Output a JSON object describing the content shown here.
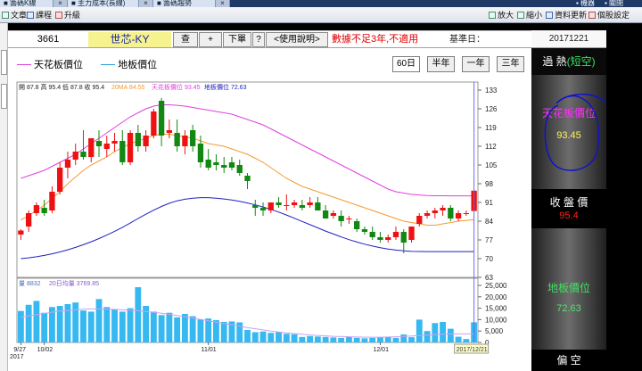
{
  "tabs": [
    {
      "label": "■ 籌碼K線",
      "width": 60
    },
    {
      "label": "■ 主力成本(長線)",
      "width": 80
    },
    {
      "label": "■ 籌碼趨勢",
      "width": 70
    }
  ],
  "tabs_right": {
    "label1": "▪ 機器",
    "label2": "▪ 關閉"
  },
  "toolbar": {
    "left": [
      {
        "icon": "file-icon",
        "label": "文章"
      },
      {
        "icon": "book-icon",
        "label": "課程"
      },
      {
        "icon": "upgrade-icon",
        "label": "升級"
      }
    ],
    "right": [
      {
        "icon": "zoom-in-icon",
        "label": "放大"
      },
      {
        "icon": "zoom-out-icon",
        "label": "縮小"
      },
      {
        "icon": "refresh-icon",
        "label": "資料更新"
      },
      {
        "icon": "settings-icon",
        "label": "個股設定"
      }
    ]
  },
  "info": {
    "code": "3661",
    "name": "世芯-KY",
    "btn_check": "查",
    "btn_add": "+",
    "btn_order": "下單",
    "btn_help": "?",
    "btn_manual": "<使用說明>",
    "warning": "數據不足3年,不適用",
    "base_label": "基準日：",
    "base_date": "20171221"
  },
  "legend": {
    "ceiling": "天花板價位",
    "floor": "地板價位"
  },
  "range_buttons": [
    {
      "label": "60日",
      "active": true
    },
    {
      "label": "半年",
      "active": false
    },
    {
      "label": "一年",
      "active": false
    },
    {
      "label": "三年",
      "active": false
    }
  ],
  "side": {
    "status_prefix": "過 熱",
    "status_suffix": "(短空)",
    "ceiling_label": "天花板價位",
    "ceiling_value": "93.45",
    "close_label": "收 盤 價",
    "close_value": "95.4",
    "floor_label": "地板價位",
    "floor_value": "72.63",
    "bottom_label": "偏 空"
  },
  "colors": {
    "up": "#ee1111",
    "down": "#118811",
    "ceiling": "#e040e0",
    "floor": "#2020c0",
    "ma20": "#f59a30",
    "volume": "#36b8f0",
    "vol_ma": "#c9a2f0"
  },
  "chart_data": {
    "type": "candlestick",
    "ohlc_header": "開 87.8 高 95.4 低 87.8 收 95.4",
    "ma_label": "20MA 84.55",
    "ceiling_label": "天花板價位 93.45",
    "floor_label": "地板價位 72.63",
    "vol_header": "量 8832",
    "vol_ma_label": "20日均量 3769.85",
    "yticks": [
      63,
      70,
      77,
      84,
      91,
      98,
      105,
      112,
      119,
      126,
      133
    ],
    "ylim": [
      63,
      136
    ],
    "vol_ticks": [
      0,
      5000,
      10000,
      15000,
      20000,
      25000
    ],
    "vol_tick_labels": [
      "0",
      "5,000",
      "10,000",
      "15,000",
      "20,000",
      "25,000"
    ],
    "vol_max": 25000,
    "x_labels": [
      {
        "index": 0,
        "label": "9/27"
      },
      {
        "index": 3,
        "label": "10/02"
      },
      {
        "index": 24,
        "label": "11/01"
      },
      {
        "index": 46,
        "label": "12/01"
      }
    ],
    "x_year": "2017",
    "cursor_label": "2017/12/21",
    "candles": [
      {
        "o": 79,
        "h": 81,
        "l": 77,
        "c": 80.5
      },
      {
        "o": 82,
        "h": 88,
        "l": 80,
        "c": 87
      },
      {
        "o": 87,
        "h": 91,
        "l": 86,
        "c": 90
      },
      {
        "o": 89,
        "h": 92,
        "l": 86,
        "c": 87
      },
      {
        "o": 88,
        "h": 97,
        "l": 87,
        "c": 95
      },
      {
        "o": 95,
        "h": 106,
        "l": 94,
        "c": 104
      },
      {
        "o": 104,
        "h": 110,
        "l": 100,
        "c": 107
      },
      {
        "o": 107,
        "h": 113,
        "l": 105,
        "c": 110
      },
      {
        "o": 110,
        "h": 118,
        "l": 107,
        "c": 108
      },
      {
        "o": 108,
        "h": 115,
        "l": 106,
        "c": 115
      },
      {
        "o": 114,
        "h": 118,
        "l": 108,
        "c": 112
      },
      {
        "o": 111,
        "h": 116,
        "l": 108,
        "c": 113
      },
      {
        "o": 113,
        "h": 117,
        "l": 110,
        "c": 114
      },
      {
        "o": 114,
        "h": 118,
        "l": 105,
        "c": 106
      },
      {
        "o": 106,
        "h": 118,
        "l": 105,
        "c": 117
      },
      {
        "o": 117,
        "h": 120,
        "l": 110,
        "c": 112
      },
      {
        "o": 112,
        "h": 118,
        "l": 110,
        "c": 116
      },
      {
        "o": 116,
        "h": 126,
        "l": 115,
        "c": 125
      },
      {
        "o": 129,
        "h": 130,
        "l": 112,
        "c": 116
      },
      {
        "o": 117,
        "h": 122,
        "l": 115,
        "c": 118
      },
      {
        "o": 117,
        "h": 122,
        "l": 110,
        "c": 112
      },
      {
        "o": 112,
        "h": 118,
        "l": 109,
        "c": 116
      },
      {
        "o": 118,
        "h": 120,
        "l": 110,
        "c": 112
      },
      {
        "o": 113,
        "h": 116,
        "l": 104,
        "c": 106
      },
      {
        "o": 107,
        "h": 111,
        "l": 103,
        "c": 104
      },
      {
        "o": 106,
        "h": 109,
        "l": 103,
        "c": 105
      },
      {
        "o": 105,
        "h": 108,
        "l": 102,
        "c": 104
      },
      {
        "o": 106,
        "h": 108,
        "l": 103,
        "c": 104
      },
      {
        "o": 105,
        "h": 107,
        "l": 101,
        "c": 102
      },
      {
        "o": 101,
        "h": 102,
        "l": 96,
        "c": 99
      },
      {
        "o": 90,
        "h": 92,
        "l": 86,
        "c": 89
      },
      {
        "o": 89,
        "h": 91,
        "l": 86,
        "c": 88
      },
      {
        "o": 88,
        "h": 91,
        "l": 87,
        "c": 91
      },
      {
        "o": 91,
        "h": 93,
        "l": 89,
        "c": 90
      },
      {
        "o": 90,
        "h": 94,
        "l": 88,
        "c": 90
      },
      {
        "o": 90,
        "h": 92,
        "l": 89,
        "c": 91
      },
      {
        "o": 90,
        "h": 92,
        "l": 88,
        "c": 89
      },
      {
        "o": 90,
        "h": 93,
        "l": 89,
        "c": 91
      },
      {
        "o": 91,
        "h": 93,
        "l": 88,
        "c": 88
      },
      {
        "o": 88,
        "h": 90,
        "l": 85,
        "c": 85
      },
      {
        "o": 86,
        "h": 88,
        "l": 85,
        "c": 87
      },
      {
        "o": 86,
        "h": 88,
        "l": 82,
        "c": 84
      },
      {
        "o": 85,
        "h": 86,
        "l": 83,
        "c": 85
      },
      {
        "o": 84,
        "h": 85,
        "l": 80,
        "c": 81
      },
      {
        "o": 81,
        "h": 82,
        "l": 79,
        "c": 80
      },
      {
        "o": 80,
        "h": 82,
        "l": 77,
        "c": 78
      },
      {
        "o": 78,
        "h": 80,
        "l": 76,
        "c": 77
      },
      {
        "o": 77,
        "h": 79,
        "l": 76,
        "c": 78
      },
      {
        "o": 78,
        "h": 82,
        "l": 77,
        "c": 80
      },
      {
        "o": 80,
        "h": 81,
        "l": 72,
        "c": 76
      },
      {
        "o": 77,
        "h": 82,
        "l": 76,
        "c": 82
      },
      {
        "o": 83,
        "h": 87,
        "l": 82,
        "c": 86
      },
      {
        "o": 86,
        "h": 88,
        "l": 85,
        "c": 87
      },
      {
        "o": 87,
        "h": 89,
        "l": 85,
        "c": 88
      },
      {
        "o": 88,
        "h": 90,
        "l": 86,
        "c": 89
      },
      {
        "o": 89,
        "h": 90,
        "l": 84,
        "c": 85
      },
      {
        "o": 85,
        "h": 88,
        "l": 84,
        "c": 87
      },
      {
        "o": 87,
        "h": 88,
        "l": 86,
        "c": 87
      },
      {
        "o": 87.8,
        "h": 95.4,
        "l": 87.8,
        "c": 95.4
      }
    ],
    "ma20": [
      84.5,
      86,
      88,
      90,
      92.5,
      95,
      98,
      100.5,
      103,
      105,
      106.5,
      108,
      110,
      111.5,
      113,
      114,
      115,
      116,
      116.5,
      116.5,
      116,
      115.5,
      115,
      114,
      113,
      112.5,
      112,
      111,
      110,
      109,
      107.5,
      106,
      104,
      102,
      100,
      98.5,
      97,
      96,
      95,
      94,
      93,
      92,
      91,
      90,
      89,
      88,
      87,
      86,
      85,
      84,
      83.5,
      83,
      82.5,
      82.5,
      83,
      83.5,
      84,
      84.3,
      84.55
    ],
    "ceiling": [
      100,
      101,
      102,
      103,
      104.5,
      106,
      107.5,
      109,
      111,
      113,
      115,
      117,
      119,
      121,
      123,
      124.5,
      126,
      127,
      127.5,
      127.5,
      127.3,
      127,
      126.5,
      126,
      125.5,
      125,
      124.5,
      124,
      123,
      122,
      121,
      120,
      118.5,
      117,
      115.5,
      114,
      112.5,
      111,
      109.5,
      108,
      106.5,
      105,
      103.5,
      102,
      100.5,
      99,
      97.5,
      96,
      95,
      94.5,
      94,
      93.8,
      93.6,
      93.5,
      93.5,
      93.45,
      93.45,
      93.45,
      93.45
    ],
    "floor": [
      70,
      70.3,
      70.7,
      71.2,
      71.8,
      72.5,
      73.3,
      74.2,
      75.2,
      76.3,
      77.5,
      78.8,
      80.2,
      81.7,
      83.3,
      85,
      86.6,
      88.1,
      89.5,
      90.7,
      91.6,
      92.2,
      92.6,
      92.8,
      92.8,
      92.6,
      92.3,
      91.9,
      91.4,
      90.8,
      90.1,
      89.3,
      88.4,
      87.4,
      86.3,
      85.1,
      83.9,
      82.7,
      81.5,
      80.3,
      79.2,
      78.1,
      77.1,
      76.2,
      75.4,
      74.7,
      74.1,
      73.6,
      73.2,
      72.9,
      72.7,
      72.65,
      72.63,
      72.63,
      72.63,
      72.63,
      72.63,
      72.63,
      72.63
    ],
    "volume": [
      13800,
      16500,
      18200,
      13000,
      15500,
      16000,
      16800,
      17500,
      14000,
      13500,
      19000,
      15500,
      14500,
      13500,
      15000,
      24200,
      16000,
      13500,
      12000,
      13000,
      11000,
      12500,
      11500,
      10000,
      10500,
      9800,
      9000,
      9200,
      8800,
      5500,
      4500,
      4800,
      4200,
      4500,
      3800,
      3600,
      2400,
      2800,
      2600,
      2400,
      2200,
      2000,
      2400,
      2000,
      1800,
      2000,
      2200,
      2500,
      2000,
      3500,
      2300,
      10000,
      5000,
      8500,
      9000,
      6000,
      2500,
      1500,
      8832
    ],
    "vol_ma": [
      11000,
      11600,
      12200,
      12700,
      13300,
      13700,
      14000,
      14300,
      14600,
      14700,
      14700,
      14600,
      14500,
      14300,
      14100,
      13900,
      13600,
      13200,
      12800,
      12300,
      11800,
      11300,
      10700,
      10100,
      9500,
      8900,
      8300,
      7700,
      7100,
      6500,
      6000,
      5500,
      5000,
      4600,
      4200,
      3900,
      3600,
      3300,
      3100,
      2900,
      2700,
      2600,
      2500,
      2400,
      2300,
      2300,
      2300,
      2400,
      2500,
      2600,
      2800,
      3000,
      3200,
      3400,
      3600,
      3700,
      3750,
      3760,
      3770
    ]
  }
}
